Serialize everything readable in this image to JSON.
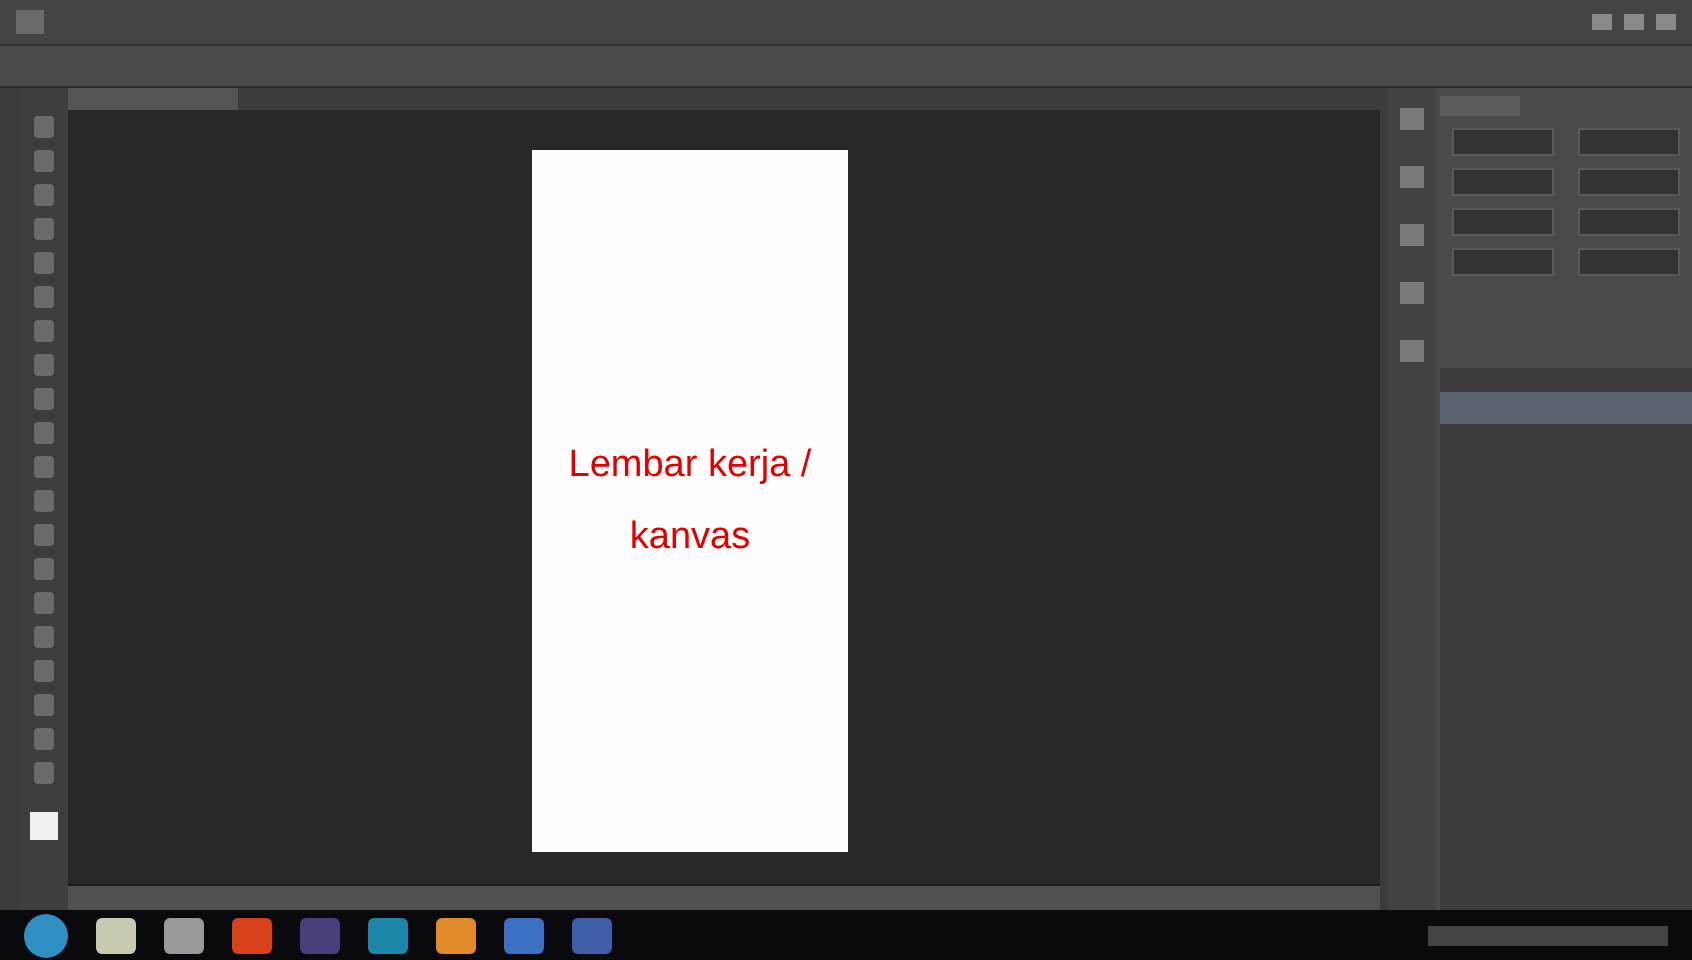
{
  "annotation": {
    "text": "Lembar kerja / kanvas"
  }
}
